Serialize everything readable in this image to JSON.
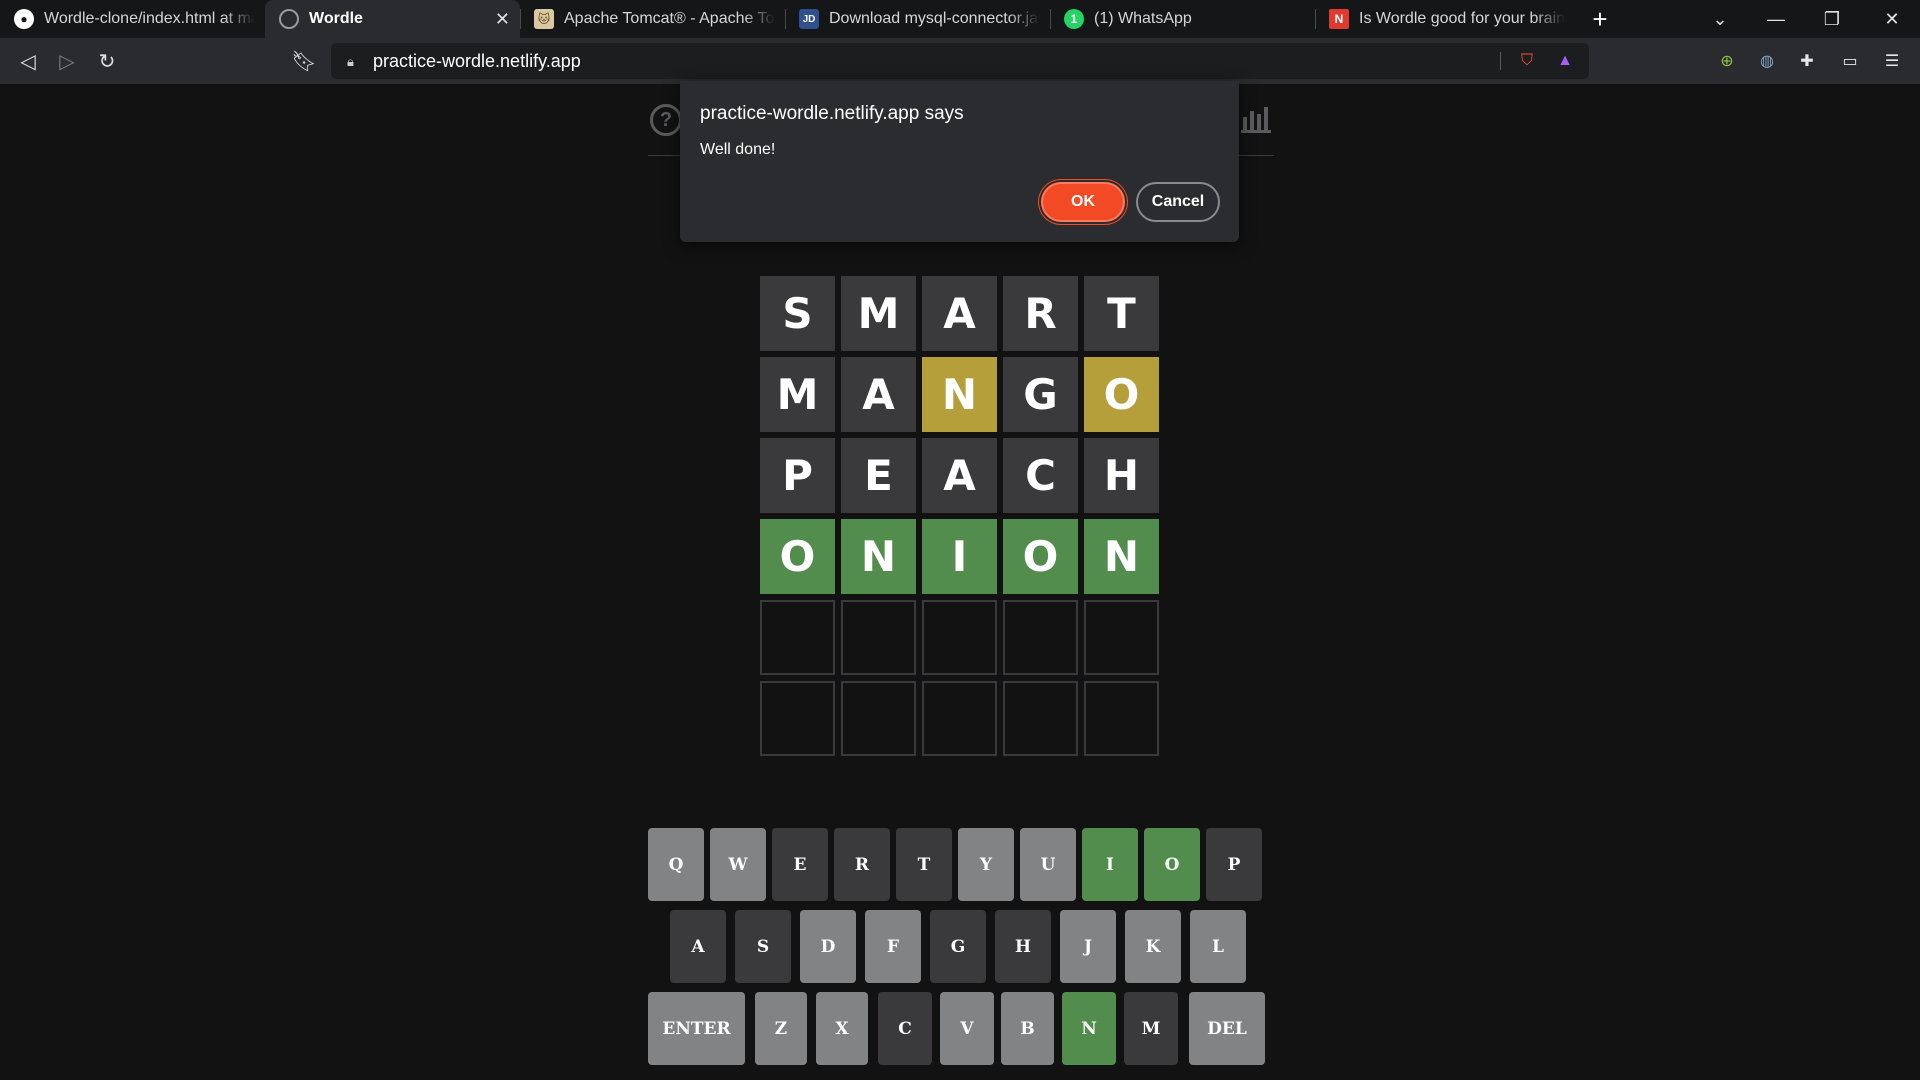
{
  "browser": {
    "tabs": [
      {
        "title": "Wordle-clone/index.html at main",
        "favicon": "github-icon",
        "active": false
      },
      {
        "title": "Wordle",
        "favicon": "globe-icon",
        "active": true
      },
      {
        "title": "Apache Tomcat® - Apache Tomc",
        "favicon": "tomcat-icon",
        "active": false
      },
      {
        "title": "Download mysql-connector.jar : m",
        "favicon": "jar-icon",
        "active": false
      },
      {
        "title": "(1) WhatsApp",
        "favicon": "whatsapp-icon",
        "active": false
      },
      {
        "title": "Is Wordle good for your brain? Th",
        "favicon": "news-icon",
        "active": false
      }
    ],
    "url": "practice-wordle.netlify.app"
  },
  "dialog": {
    "title": "practice-wordle.netlify.app says",
    "message": "Well done!",
    "ok_label": "OK",
    "cancel_label": "Cancel"
  },
  "colors": {
    "correct": "#538d4e",
    "present": "#b59f3b",
    "absent": "#3a3a3c",
    "key_default": "#818384",
    "accent_ok": "#f24a25"
  },
  "board": {
    "rows": [
      [
        {
          "letter": "S",
          "state": "absent"
        },
        {
          "letter": "M",
          "state": "absent"
        },
        {
          "letter": "A",
          "state": "absent"
        },
        {
          "letter": "R",
          "state": "absent"
        },
        {
          "letter": "T",
          "state": "absent"
        }
      ],
      [
        {
          "letter": "M",
          "state": "absent"
        },
        {
          "letter": "A",
          "state": "absent"
        },
        {
          "letter": "N",
          "state": "present"
        },
        {
          "letter": "G",
          "state": "absent"
        },
        {
          "letter": "O",
          "state": "present"
        }
      ],
      [
        {
          "letter": "P",
          "state": "absent"
        },
        {
          "letter": "E",
          "state": "absent"
        },
        {
          "letter": "A",
          "state": "absent"
        },
        {
          "letter": "C",
          "state": "absent"
        },
        {
          "letter": "H",
          "state": "absent"
        }
      ],
      [
        {
          "letter": "O",
          "state": "correct"
        },
        {
          "letter": "N",
          "state": "correct"
        },
        {
          "letter": "I",
          "state": "correct"
        },
        {
          "letter": "O",
          "state": "correct"
        },
        {
          "letter": "N",
          "state": "correct"
        }
      ],
      [
        {
          "letter": "",
          "state": "empty"
        },
        {
          "letter": "",
          "state": "empty"
        },
        {
          "letter": "",
          "state": "empty"
        },
        {
          "letter": "",
          "state": "empty"
        },
        {
          "letter": "",
          "state": "empty"
        }
      ],
      [
        {
          "letter": "",
          "state": "empty"
        },
        {
          "letter": "",
          "state": "empty"
        },
        {
          "letter": "",
          "state": "empty"
        },
        {
          "letter": "",
          "state": "empty"
        },
        {
          "letter": "",
          "state": "empty"
        }
      ]
    ]
  },
  "keyboard": {
    "rows": [
      [
        {
          "label": "Q",
          "state": "default"
        },
        {
          "label": "W",
          "state": "default"
        },
        {
          "label": "E",
          "state": "absent"
        },
        {
          "label": "R",
          "state": "absent"
        },
        {
          "label": "T",
          "state": "absent"
        },
        {
          "label": "Y",
          "state": "default"
        },
        {
          "label": "U",
          "state": "default"
        },
        {
          "label": "I",
          "state": "correct"
        },
        {
          "label": "O",
          "state": "correct"
        },
        {
          "label": "P",
          "state": "absent"
        }
      ],
      [
        {
          "label": "A",
          "state": "absent"
        },
        {
          "label": "S",
          "state": "absent"
        },
        {
          "label": "D",
          "state": "default"
        },
        {
          "label": "F",
          "state": "default"
        },
        {
          "label": "G",
          "state": "absent"
        },
        {
          "label": "H",
          "state": "absent"
        },
        {
          "label": "J",
          "state": "default"
        },
        {
          "label": "K",
          "state": "default"
        },
        {
          "label": "L",
          "state": "default"
        }
      ],
      [
        {
          "label": "ENTER",
          "state": "default",
          "wide": true
        },
        {
          "label": "Z",
          "state": "default"
        },
        {
          "label": "X",
          "state": "default"
        },
        {
          "label": "C",
          "state": "absent"
        },
        {
          "label": "V",
          "state": "default"
        },
        {
          "label": "B",
          "state": "default"
        },
        {
          "label": "N",
          "state": "correct"
        },
        {
          "label": "M",
          "state": "absent"
        },
        {
          "label": "DEL",
          "state": "default",
          "wide": true
        }
      ]
    ]
  }
}
